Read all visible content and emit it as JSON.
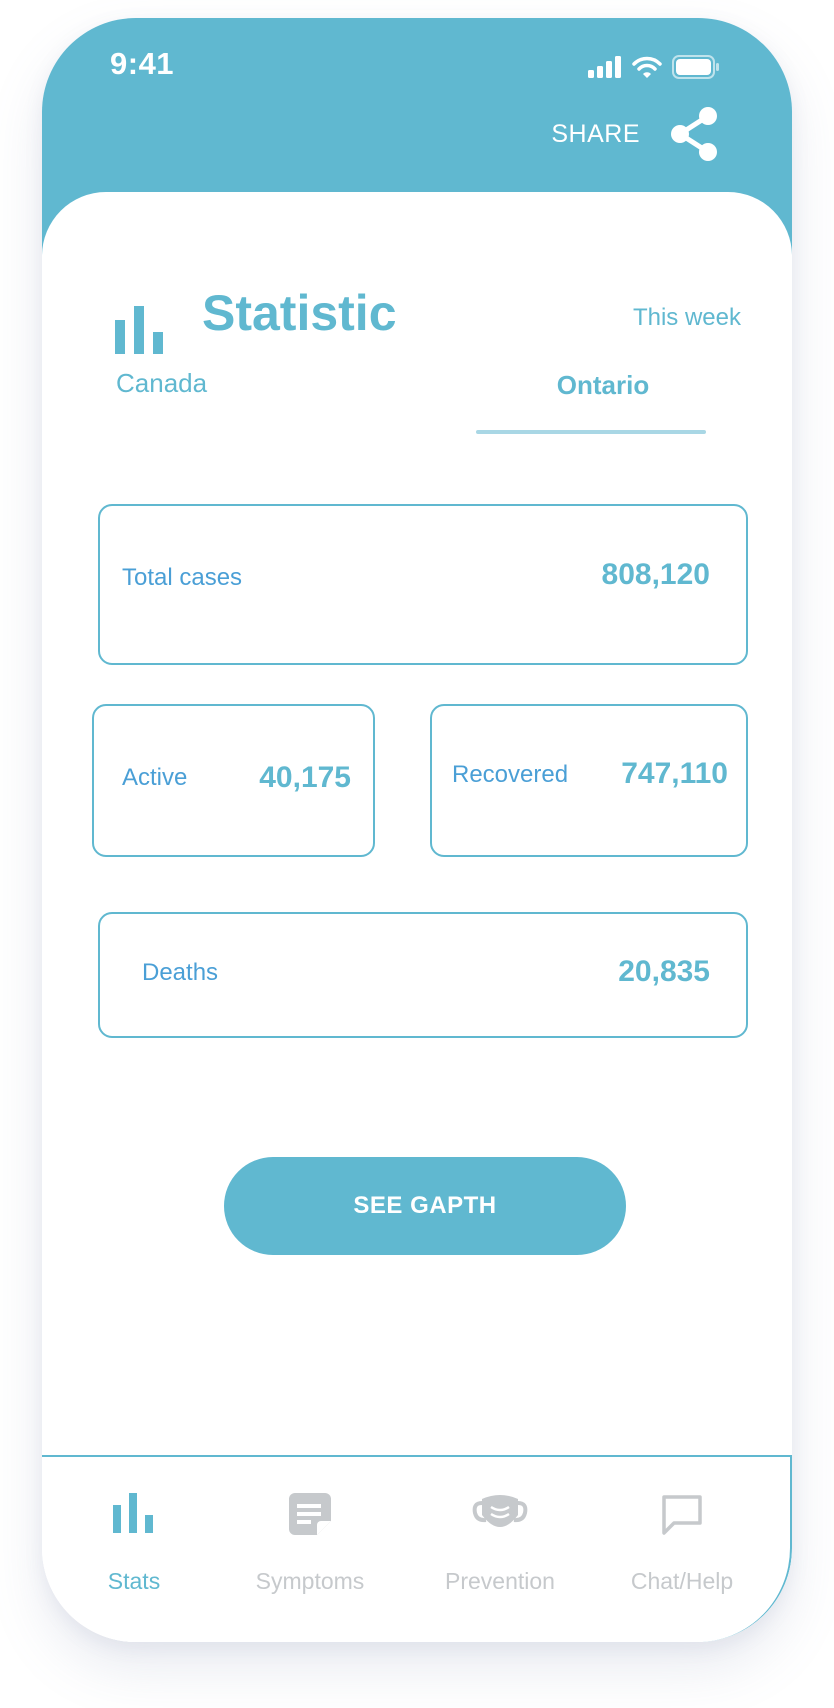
{
  "colors": {
    "accent": "#60b8d0",
    "value_blue": "#4a9fd6",
    "inactive": "#c6c9cc",
    "underline": "#a9d7e5"
  },
  "status_bar": {
    "time": "9:41",
    "icons": [
      "signal-icon",
      "wifi-icon",
      "battery-icon"
    ]
  },
  "header": {
    "share_label": "SHARE",
    "share_icon": "share-icon"
  },
  "page": {
    "title": "Statistic",
    "title_icon": "bar-chart-icon",
    "period": "This week",
    "tabs": [
      {
        "label": "Canada",
        "active": false
      },
      {
        "label": "Ontario",
        "active": true
      }
    ]
  },
  "stats": {
    "total": {
      "label": "Total cases",
      "value": "808,120"
    },
    "active": {
      "label": "Active",
      "value": "40,175"
    },
    "recovered": {
      "label": "Recovered",
      "value": "747,110"
    },
    "deaths": {
      "label": "Deaths",
      "value": "20,835"
    }
  },
  "cta": {
    "label": "SEE GAPTH"
  },
  "nav": {
    "items": [
      {
        "label": "Stats",
        "icon": "bar-chart-icon",
        "active": true
      },
      {
        "label": "Symptoms",
        "icon": "note-icon",
        "active": false
      },
      {
        "label": "Prevention",
        "icon": "mask-icon",
        "active": false
      },
      {
        "label": "Chat/Help",
        "icon": "chat-bubble-icon",
        "active": false
      }
    ]
  }
}
